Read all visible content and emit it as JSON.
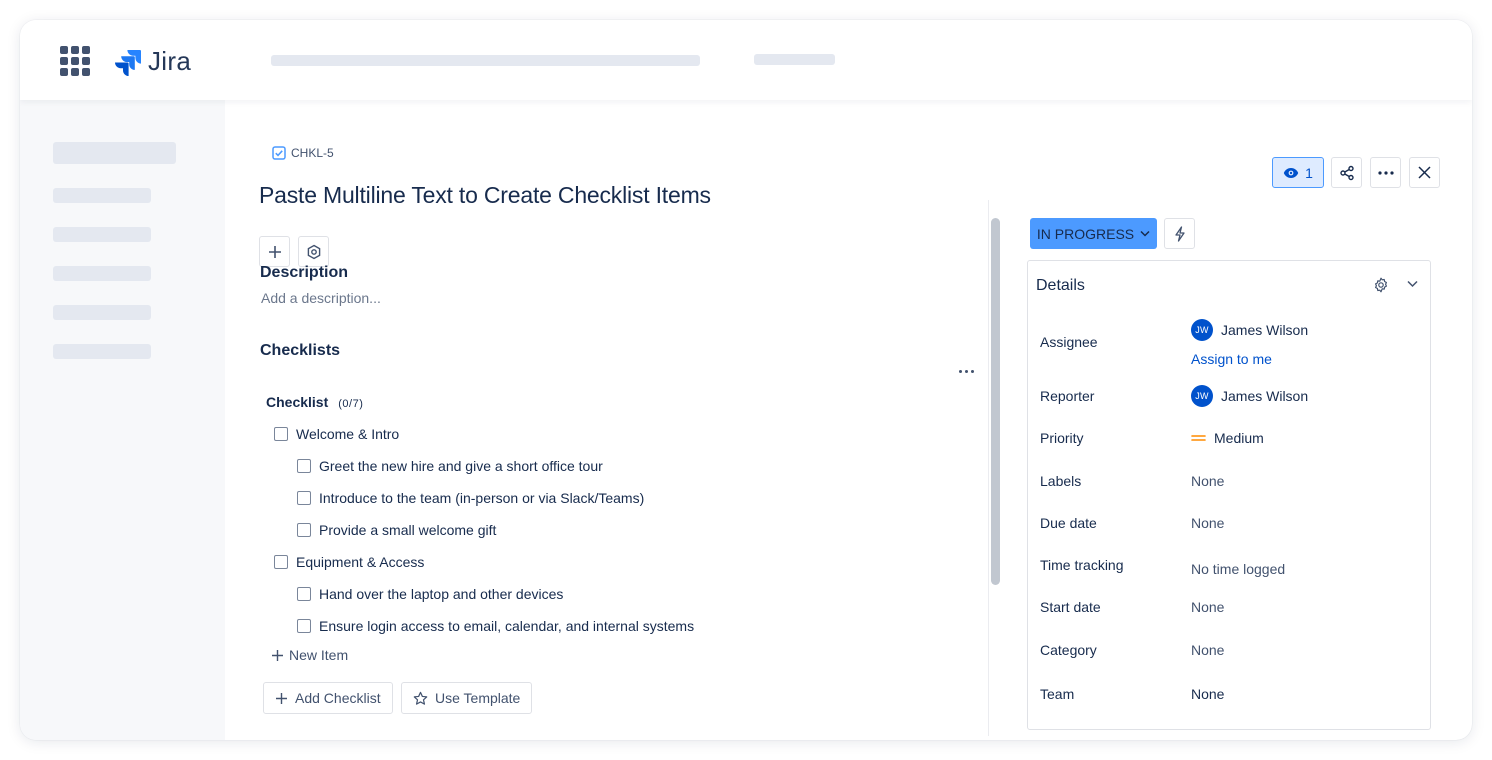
{
  "app": {
    "name": "Jira",
    "brand_color": "#2684FF"
  },
  "topbar": {
    "app_switcher_icon": "grid-icon"
  },
  "issue": {
    "key": "CHKL-5",
    "type_icon": "checkbox-checked-icon",
    "title": "Paste Multiline Text to Create Checklist Items",
    "add_icon": "plus-icon",
    "settings_icon": "hexagon-gear-icon"
  },
  "description": {
    "title": "Description",
    "placeholder": "Add a description..."
  },
  "checklists": {
    "title": "Checklists",
    "checklist_name": "Checklist",
    "checklist_count": "(0/7)",
    "items": [
      {
        "label": "Welcome & Intro",
        "level": 0,
        "checked": false
      },
      {
        "label": "Greet the new hire and give a short office tour",
        "level": 1,
        "checked": false
      },
      {
        "label": "Introduce to the team (in-person or via Slack/Teams)",
        "level": 1,
        "checked": false
      },
      {
        "label": "Provide a small welcome gift",
        "level": 1,
        "checked": false
      },
      {
        "label": "Equipment & Access",
        "level": 0,
        "checked": false
      },
      {
        "label": "Hand over the laptop and other devices",
        "level": 1,
        "checked": false
      },
      {
        "label": "Ensure login access to email, calendar, and internal systems",
        "level": 1,
        "checked": false
      }
    ],
    "new_item_label": "New Item",
    "add_checklist_label": "Add Checklist",
    "use_template_label": "Use Template"
  },
  "actions": {
    "watch_count": "1",
    "watch_icon": "eye-icon",
    "share_icon": "share-icon",
    "more_icon": "more-icon",
    "close_icon": "close-icon"
  },
  "status": {
    "label": "IN PROGRESS",
    "color": "#4C9AFF",
    "automation_icon": "lightning-icon"
  },
  "details": {
    "title": "Details",
    "fields": {
      "assignee": {
        "label": "Assignee",
        "value": "James Wilson",
        "initials": "JW",
        "assign_to_me": "Assign to me"
      },
      "reporter": {
        "label": "Reporter",
        "value": "James Wilson",
        "initials": "JW"
      },
      "priority": {
        "label": "Priority",
        "value": "Medium",
        "color": "#FF8B00"
      },
      "labels": {
        "label": "Labels",
        "value": "None"
      },
      "due_date": {
        "label": "Due date",
        "value": "None"
      },
      "time_tracking": {
        "label": "Time tracking",
        "value": "No time logged"
      },
      "start_date": {
        "label": "Start date",
        "value": "None"
      },
      "category": {
        "label": "Category",
        "value": "None"
      },
      "team": {
        "label": "Team",
        "value": "None"
      }
    }
  }
}
